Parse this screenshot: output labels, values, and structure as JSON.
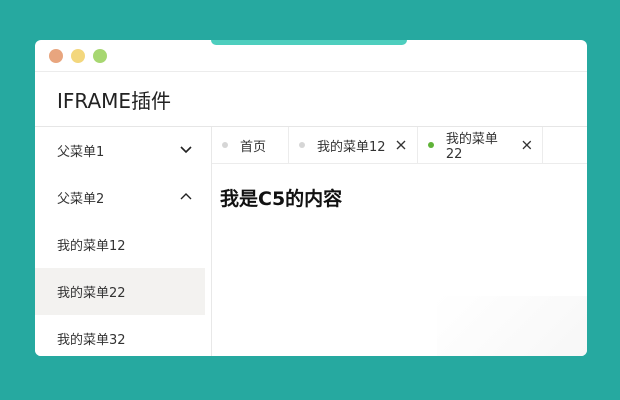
{
  "app": {
    "title": "IFRAME插件"
  },
  "sidebar": {
    "items": [
      {
        "label": "父菜单1",
        "expandable": true,
        "expanded": false,
        "icon": "chevron-down-icon"
      },
      {
        "label": "父菜单2",
        "expandable": true,
        "expanded": true,
        "icon": "chevron-up-icon"
      },
      {
        "label": "我的菜单12",
        "active": false
      },
      {
        "label": "我的菜单22",
        "active": true
      },
      {
        "label": "我的菜单32",
        "active": false
      }
    ]
  },
  "tabs": [
    {
      "label": "首页",
      "closable": false,
      "active": false
    },
    {
      "label": "我的菜单12",
      "closable": true,
      "active": false
    },
    {
      "label": "我的菜单22",
      "closable": true,
      "active": true
    }
  ],
  "content": {
    "heading": "我是C5的内容"
  },
  "colors": {
    "background": "#26a9a0",
    "active_tab_dot": "#5fb338",
    "inactive_tab_dot": "#d6d6d6",
    "active_menu_bg": "#f3f2f0"
  }
}
